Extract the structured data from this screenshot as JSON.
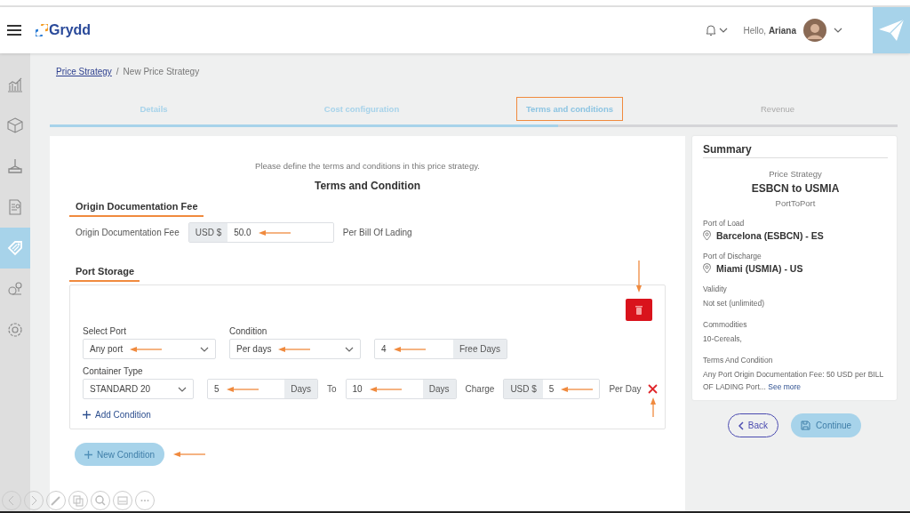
{
  "header": {
    "logo": "Grydd",
    "greeting": "Hello,",
    "user": "Ariana"
  },
  "sidebar": {
    "items": [
      {
        "kind": "chart",
        "selected": false
      },
      {
        "kind": "box",
        "selected": false
      },
      {
        "kind": "crane",
        "selected": false
      },
      {
        "kind": "report",
        "selected": false
      },
      {
        "kind": "tag",
        "selected": true
      },
      {
        "kind": "pins",
        "selected": false
      },
      {
        "kind": "gear",
        "selected": false
      }
    ]
  },
  "breadcrumb": {
    "parent": "Price Strategy",
    "separator": "/",
    "current": "New Price Strategy"
  },
  "steps": [
    {
      "label": "Details",
      "reached": true,
      "selected": false,
      "highlighted": false
    },
    {
      "label": "Cost configuration",
      "reached": true,
      "selected": false,
      "highlighted": false
    },
    {
      "label": "Terms and conditions",
      "reached": true,
      "selected": true,
      "highlighted": true
    },
    {
      "label": "Revenue",
      "reached": false,
      "selected": false,
      "highlighted": false
    }
  ],
  "progress": {
    "level": 0.6
  },
  "form": {
    "intro": "Please define the terms and conditions in this price strategy.",
    "title": "Terms and Condition",
    "origin_fee": {
      "heading": "Origin Documentation Fee",
      "label": "Origin Documentation Fee",
      "prefix": "USD $",
      "value": "50.0",
      "annotated": true,
      "suffix": "Per Bill Of Lading"
    },
    "port_storage": {
      "heading": "Port Storage",
      "delete_annotated": true,
      "select_port": {
        "label": "Select Port",
        "value": "Any port",
        "annotated": true
      },
      "condition": {
        "label": "Condition",
        "value": "Per days",
        "annotated": true
      },
      "free_days": {
        "value": "4",
        "suffix": "Free Days",
        "annotated": true
      },
      "container_type": {
        "label": "Container Type",
        "value": "STANDARD 20"
      },
      "from": {
        "value": "5",
        "suffix": "Days",
        "annotated": true
      },
      "to_label": "To",
      "to": {
        "value": "10",
        "suffix": "Days",
        "annotated": true
      },
      "charge": {
        "label": "Charge",
        "prefix": "USD $",
        "value": "5",
        "annotated": true,
        "suffix": "Per Day"
      },
      "remove_annotated": true,
      "add_condition": "Add Condition"
    },
    "new_condition": {
      "label": "New Condition",
      "annotated": true
    }
  },
  "summary": {
    "title": "Summary",
    "strategy_label": "Price Strategy",
    "strategy_name": "ESBCN to USMIA",
    "strategy_type": "PortToPort",
    "sections": [
      {
        "label": "Port of Load",
        "value": "Barcelona (ESBCN) - ES",
        "kind": "place"
      },
      {
        "label": "Port of Discharge",
        "value": "Miami (USMIA) - US",
        "kind": "place"
      },
      {
        "label": "Validity",
        "value": "Not set (unlimited)",
        "kind": "plain"
      },
      {
        "label": "Commodities",
        "value": "10-Cereals,",
        "kind": "plain"
      },
      {
        "label": "Terms And Condition",
        "value": "Any Port Origin Documentation Fee: 50 USD per BILL OF LADING Port...",
        "link": "See more",
        "kind": "plain"
      }
    ]
  },
  "buttons": {
    "back": "Back",
    "continue": "Continue",
    "continue_disabled": true
  }
}
